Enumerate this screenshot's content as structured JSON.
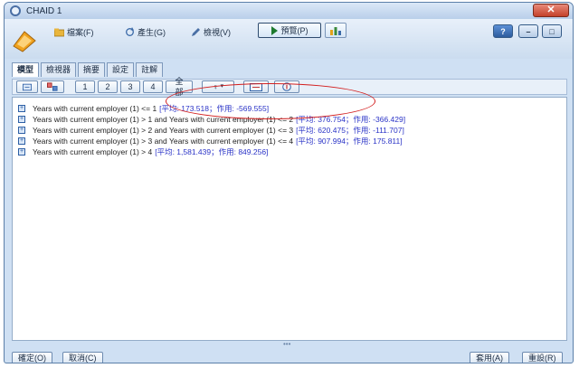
{
  "window": {
    "title": "CHAID 1"
  },
  "menu": {
    "items": [
      {
        "label": "檔案(F)",
        "icon": "folder-icon"
      },
      {
        "label": "產生(G)",
        "icon": "refresh-icon"
      },
      {
        "label": "檢視(V)",
        "icon": "pencil-icon"
      }
    ],
    "run_label": "預覽(P)"
  },
  "tabs": [
    "模型",
    "檢視器",
    "摘要",
    "設定",
    "註解"
  ],
  "toolbar": {
    "levels": [
      "1",
      "2",
      "3",
      "4",
      "全部"
    ]
  },
  "rules": [
    {
      "condition": "Years with current employer (1) <= 1",
      "stats": "[平均: 173.518；作用: -569.555]"
    },
    {
      "condition": "Years with current employer (1) > 1 and Years with current employer (1) <= 2",
      "stats": "[平均: 376.754；作用: -366.429]"
    },
    {
      "condition": "Years with current employer (1) > 2 and Years with current employer (1) <= 3",
      "stats": "[平均: 620.475；作用: -111.707]"
    },
    {
      "condition": "Years with current employer (1) > 3 and Years with current employer (1) <= 4",
      "stats": "[平均: 907.994；作用: 175.811]"
    },
    {
      "condition": "Years with current employer (1) > 4",
      "stats": "[平均: 1,581.439；作用: 849.256]"
    }
  ],
  "buttons": {
    "ok": "確定(O)",
    "cancel": "取消(C)",
    "apply": "套用(A)",
    "reset": "重設(R)"
  },
  "colors": {
    "stats_text": "#2a33c7",
    "highlight": "#d32020",
    "close_button": "#c4412a"
  }
}
